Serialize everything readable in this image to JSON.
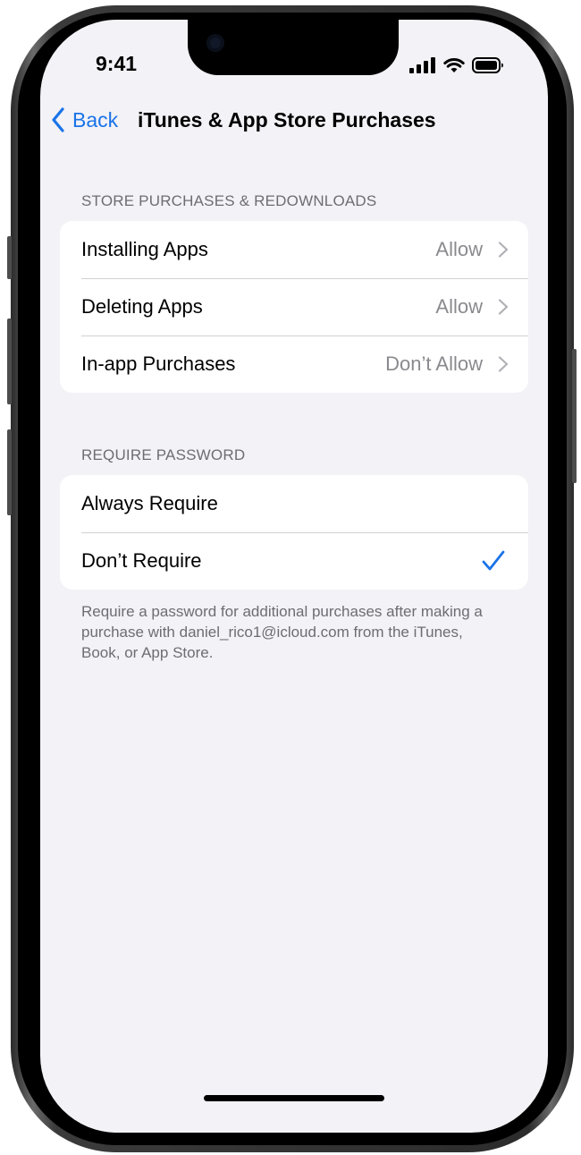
{
  "status_bar": {
    "time": "9:41",
    "icons": [
      "cellular-signal-icon",
      "wifi-icon",
      "battery-icon"
    ]
  },
  "nav": {
    "back_label": "Back",
    "title": "iTunes & App Store Purchases"
  },
  "sections": [
    {
      "header": "STORE PURCHASES & REDOWNLOADS",
      "rows": [
        {
          "label": "Installing Apps",
          "value": "Allow"
        },
        {
          "label": "Deleting Apps",
          "value": "Allow"
        },
        {
          "label": "In-app Purchases",
          "value": "Don’t Allow"
        }
      ]
    },
    {
      "header": "REQUIRE PASSWORD",
      "rows": [
        {
          "label": "Always Require",
          "selected": false
        },
        {
          "label": "Don’t Require",
          "selected": true
        }
      ],
      "footer": "Require a password for additional purchases after making a purchase with daniel_rico1@icloud.com from the iTunes, Book, or App Store."
    }
  ],
  "colors": {
    "accent": "#1a73e8",
    "background": "#f2f2f7",
    "secondary_text": "#8a8a8e"
  }
}
